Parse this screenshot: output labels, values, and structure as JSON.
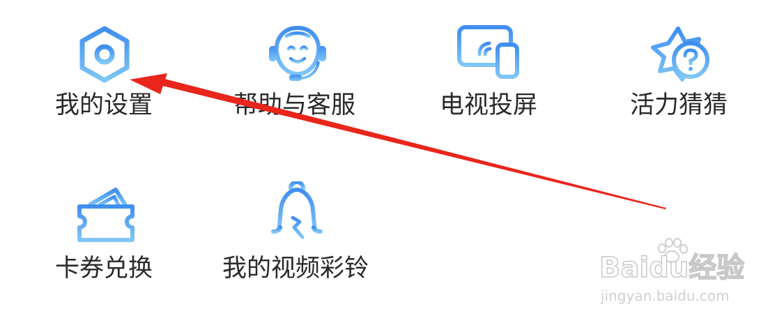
{
  "colors": {
    "icon_gradient_top": "#3f8ef0",
    "icon_gradient_bottom": "#7cc4f5",
    "label_text": "#2a2a2a",
    "annotation_arrow": "#e8261c",
    "watermark": "#c8c8c8"
  },
  "menu": {
    "items": [
      {
        "label": "我的设置",
        "icon": "hexagon-settings-icon"
      },
      {
        "label": "帮助与客服",
        "icon": "headset-service-icon"
      },
      {
        "label": "电视投屏",
        "icon": "tv-cast-icon"
      },
      {
        "label": "活力猜猜",
        "icon": "star-question-icon"
      },
      {
        "label": "卡券兑换",
        "icon": "coupon-ticket-icon"
      },
      {
        "label": "我的视频彩铃",
        "icon": "bell-ringtone-icon"
      }
    ]
  },
  "annotation": {
    "type": "arrow",
    "color_name": "red",
    "points_to": "我的设置"
  },
  "watermark": {
    "brand": "Baidu经验",
    "url": "jingyan.baidu.com"
  }
}
